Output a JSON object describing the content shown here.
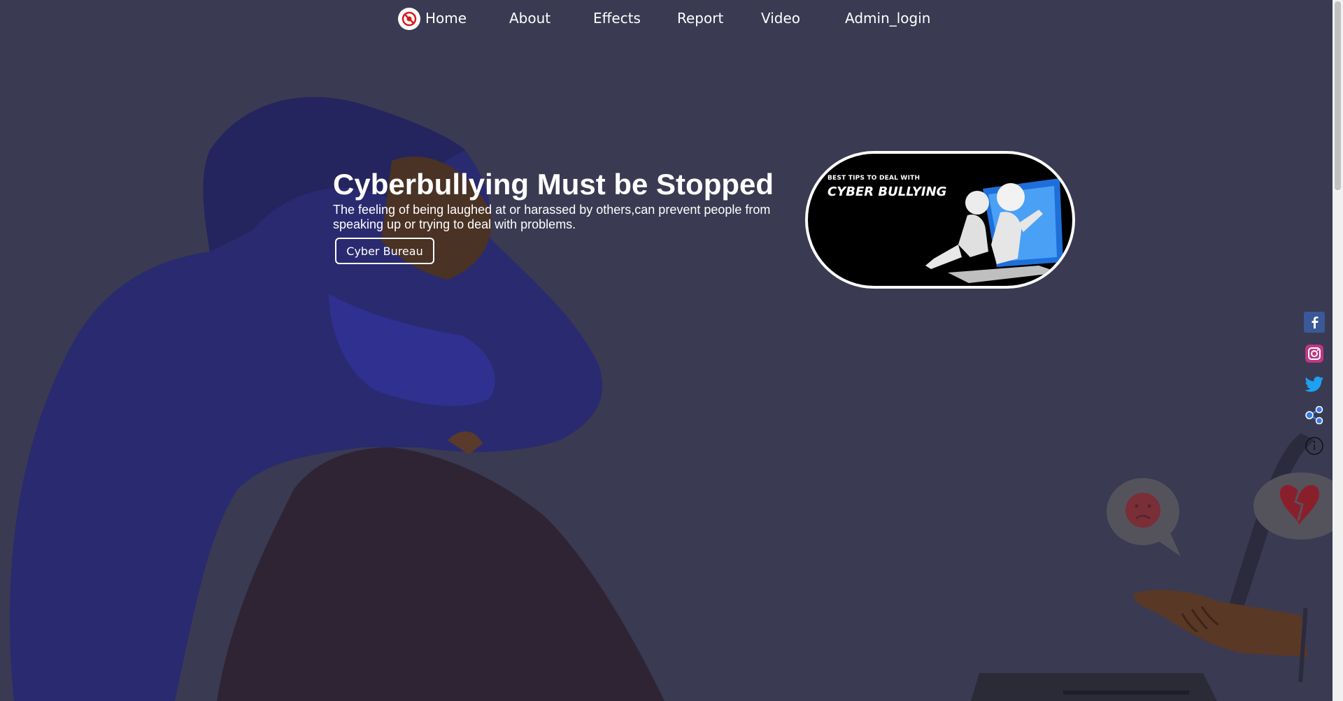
{
  "nav": {
    "logo_icon": "stop-bullying-logo-icon",
    "items": [
      {
        "label": "Home"
      },
      {
        "label": "About"
      },
      {
        "label": "Effects"
      },
      {
        "label": "Report"
      },
      {
        "label": "Video"
      },
      {
        "label": "Admin_login"
      }
    ]
  },
  "hero": {
    "title": "Cyberbullying Must be Stopped",
    "text": "The feeling of being laughed at or harassed by others,can prevent people from speaking up or trying to deal with problems.",
    "button_label": "Cyber Bureau"
  },
  "promo": {
    "small_text": "BEST TIPS TO DEAL WITH",
    "big_text": "CYBER BULLYING"
  },
  "social": [
    {
      "icon": "facebook-icon"
    },
    {
      "icon": "instagram-icon"
    },
    {
      "icon": "twitter-icon"
    },
    {
      "icon": "share-icon"
    },
    {
      "icon": "info-icon"
    }
  ],
  "colors": {
    "background": "#3a3a52",
    "hoodie": "#2a2a6e",
    "legs": "#2e2434",
    "skin": "#5a3a2a"
  }
}
